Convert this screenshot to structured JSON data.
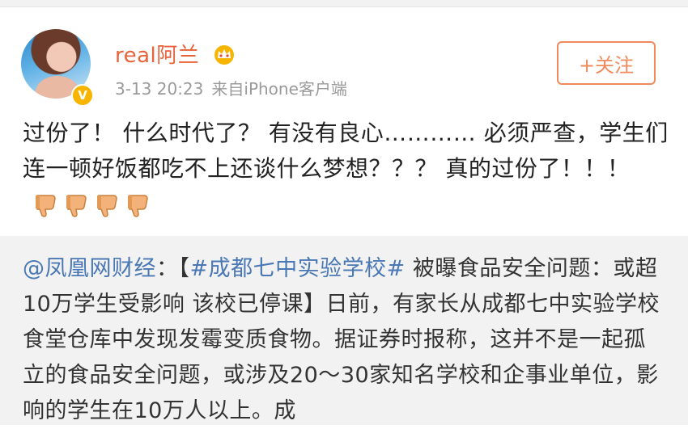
{
  "post": {
    "username": "real阿兰",
    "time": "3-13 20:23",
    "source": "来自iPhone客户端",
    "follow_label": "+关注",
    "verified_label": "V",
    "text": "过份了！ 什么时代了？ 有没有良心………… 必须严查，学生们连一顿好饭都吃不上还谈什么梦想？？？ 真的过份了！！！",
    "emoji": [
      "thumbs-down-icon",
      "thumbs-down-icon",
      "thumbs-down-icon",
      "thumbs-down-icon"
    ]
  },
  "repost": {
    "source": "@凤凰网财经",
    "prefix": "：【",
    "topic": "#成都七中实验学校#",
    "text": " 被曝食品安全问题：或超10万学生受影响 该校已停课】日前，有家长从成都七中实验学校食堂仓库中发现发霉变质食物。据证券时报称，这并不是一起孤立的食品安全问题，或涉及20～30家知名学校和企事业单位，影响的学生在10万人以上。成"
  },
  "colors": {
    "username": "#e8623a",
    "link": "#4a78b5",
    "follow": "#f08a5d",
    "badge": "#f7b500"
  }
}
